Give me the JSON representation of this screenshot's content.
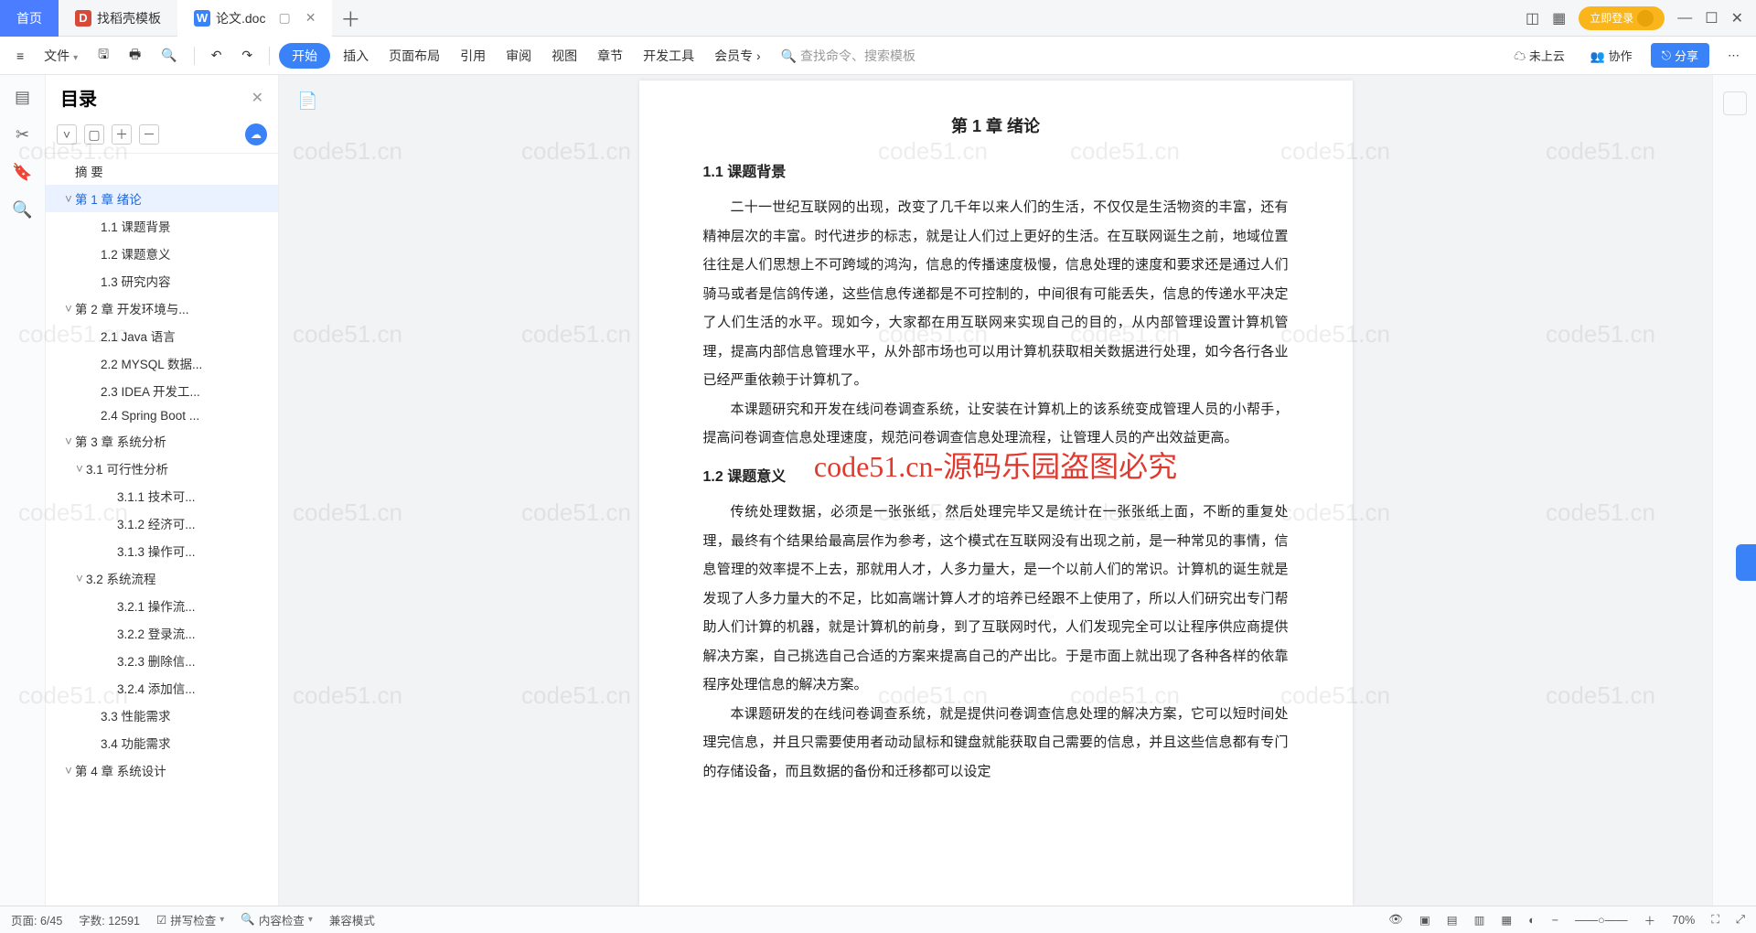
{
  "tabs": {
    "home": "首页",
    "t1": "找稻壳模板",
    "t2": "论文.doc",
    "login": "立即登录"
  },
  "ribbon": {
    "file": "文件",
    "start": "开始",
    "insert": "插入",
    "page": "页面布局",
    "ref": "引用",
    "review": "审阅",
    "view": "视图",
    "chapter": "章节",
    "dev": "开发工具",
    "vip": "会员专",
    "search": "查找命令、搜索模板",
    "cloud": "未上云",
    "coop": "协作",
    "share": "分享"
  },
  "outline": {
    "title": "目录",
    "nodes": [
      {
        "ind": 0,
        "label": "摘  要"
      },
      {
        "ind": 0,
        "label": "第 1 章  绪论",
        "tw": "˅",
        "sel": true
      },
      {
        "ind": 2,
        "label": "1.1  课题背景"
      },
      {
        "ind": 2,
        "label": "1.2  课题意义"
      },
      {
        "ind": 2,
        "label": "1.3  研究内容"
      },
      {
        "ind": 0,
        "label": "第 2 章  开发环境与...",
        "tw": "˅"
      },
      {
        "ind": 2,
        "label": "2.1 Java 语言"
      },
      {
        "ind": 2,
        "label": "2.2 MYSQL 数据..."
      },
      {
        "ind": 2,
        "label": "2.3 IDEA 开发工..."
      },
      {
        "ind": 2,
        "label": "2.4 Spring Boot ..."
      },
      {
        "ind": 0,
        "label": "第 3 章  系统分析",
        "tw": "˅"
      },
      {
        "ind": 1,
        "label": "3.1 可行性分析",
        "tw": "˅"
      },
      {
        "ind": 3,
        "label": "3.1.1  技术可..."
      },
      {
        "ind": 3,
        "label": "3.1.2  经济可..."
      },
      {
        "ind": 3,
        "label": "3.1.3  操作可..."
      },
      {
        "ind": 1,
        "label": "3.2  系统流程",
        "tw": "˅"
      },
      {
        "ind": 3,
        "label": "3.2.1  操作流..."
      },
      {
        "ind": 3,
        "label": "3.2.2  登录流..."
      },
      {
        "ind": 3,
        "label": "3.2.3  删除信..."
      },
      {
        "ind": 3,
        "label": "3.2.4  添加信..."
      },
      {
        "ind": 2,
        "label": "3.3  性能需求"
      },
      {
        "ind": 2,
        "label": "3.4  功能需求"
      },
      {
        "ind": 0,
        "label": "第 4 章  系统设计",
        "tw": "˅"
      }
    ]
  },
  "doc": {
    "h1": "第 1 章  绪论",
    "s1": "1.1  课题背景",
    "p1": "二十一世纪互联网的出现，改变了几千年以来人们的生活，不仅仅是生活物资的丰富，还有精神层次的丰富。时代进步的标志，就是让人们过上更好的生活。在互联网诞生之前，地域位置往往是人们思想上不可跨域的鸿沟，信息的传播速度极慢，信息处理的速度和要求还是通过人们骑马或者是信鸽传递，这些信息传递都是不可控制的，中间很有可能丢失，信息的传递水平决定了人们生活的水平。现如今，大家都在用互联网来实现自己的目的，从内部管理设置计算机管理，提高内部信息管理水平，从外部市场也可以用计算机获取相关数据进行处理，如今各行各业已经严重依赖于计算机了。",
    "p2": "本课题研究和开发在线问卷调查系统，让安装在计算机上的该系统变成管理人员的小帮手，提高问卷调查信息处理速度，规范问卷调查信息处理流程，让管理人员的产出效益更高。",
    "s2": "1.2  课题意义",
    "p3": "传统处理数据，必须是一张张纸，然后处理完毕又是统计在一张张纸上面，不断的重复处理，最终有个结果给最高层作为参考，这个模式在互联网没有出现之前，是一种常见的事情，信息管理的效率提不上去，那就用人才，人多力量大，是一个以前人们的常识。计算机的诞生就是发现了人多力量大的不足，比如高端计算人才的培养已经跟不上使用了，所以人们研究出专门帮助人们计算的机器，就是计算机的前身，到了互联网时代，人们发现完全可以让程序供应商提供解决方案，自己挑选自己合适的方案来提高自己的产出比。于是市面上就出现了各种各样的依靠程序处理信息的解决方案。",
    "p4": "本课题研发的在线问卷调查系统，就是提供问卷调查信息处理的解决方案，它可以短时间处理完信息，并且只需要使用者动动鼠标和键盘就能获取自己需要的信息，并且这些信息都有专门的存储设备，而且数据的备份和迁移都可以设定",
    "watermark": "code51.cn-源码乐园盗图必究"
  },
  "status": {
    "page": "页面: 6/45",
    "words": "字数: 12591",
    "spell": "拼写检查",
    "content": "内容检查",
    "mode": "兼容模式",
    "zoom": "70%"
  }
}
